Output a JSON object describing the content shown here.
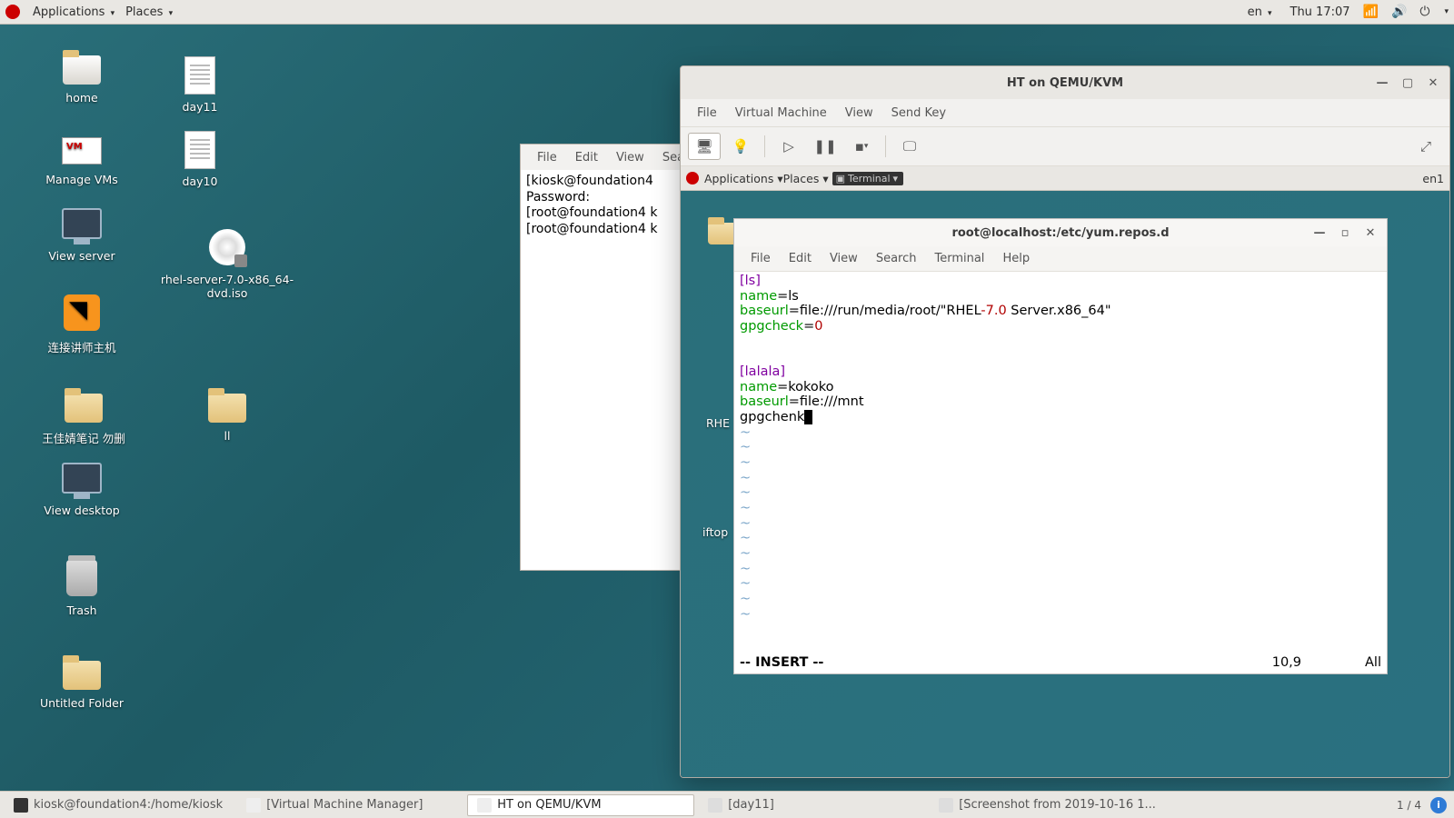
{
  "topbar": {
    "applications": "Applications",
    "places": "Places",
    "lang": "en",
    "clock": "Thu 17:07"
  },
  "desktop": {
    "home": "home",
    "day11": "day11",
    "manage_vms": "Manage VMs",
    "day10": "day10",
    "view_server": "View server",
    "iso": "rhel-server-7.0-x86_64-dvd.iso",
    "tigervnc": "连接讲师主机",
    "folder1": "王佳婧笔记 勿删",
    "ll": "ll",
    "view_desktop": "View desktop",
    "trash": "Trash",
    "untitled": "Untitled Folder"
  },
  "host_term": {
    "menu": {
      "file": "File",
      "edit": "Edit",
      "view": "View",
      "search": "Search"
    },
    "lines": [
      "[kiosk@foundation4",
      "Password:",
      "[root@foundation4 k",
      "[root@foundation4 k"
    ]
  },
  "vmwin": {
    "title": "HT on QEMU/KVM",
    "menu": {
      "file": "File",
      "vm": "Virtual Machine",
      "view": "View",
      "sendkey": "Send Key"
    },
    "innerbar": {
      "applications": "Applications",
      "places": "Places",
      "terminal": "Terminal",
      "lang": "en1"
    },
    "peek": {
      "rhel": "RHE",
      "iftop": "iftop"
    }
  },
  "guest_term": {
    "title": "root@localhost:/etc/yum.repos.d",
    "menu": {
      "file": "File",
      "edit": "Edit",
      "view": "View",
      "search": "Search",
      "terminal": "Terminal",
      "help": "Help"
    },
    "content": {
      "s1": "[ls]",
      "l1k": "name",
      "l1v": "=ls",
      "l2k": "baseurl",
      "l2v": "=file:///run/media/root/\"RHEL",
      "l2n": "-7.0",
      "l2r": " Server.x86_64\"",
      "l3k": "gpgcheck",
      "l3e": "=",
      "l3n": "0",
      "s2": "[lalala]",
      "l4k": "name",
      "l4v": "=kokoko",
      "l5k": "baseurl",
      "l5v": "=file:///mnt",
      "l6": "gpgchenk"
    },
    "status": {
      "mode": "-- INSERT --",
      "pos": "10,9",
      "pct": "All"
    }
  },
  "taskbar": {
    "t1": "kiosk@foundation4:/home/kiosk",
    "t2": "[Virtual Machine Manager]",
    "t3": "HT on QEMU/KVM",
    "t4": "[day11]",
    "t5": "[Screenshot from 2019-10-16 1...",
    "ws": "1 / 4"
  }
}
